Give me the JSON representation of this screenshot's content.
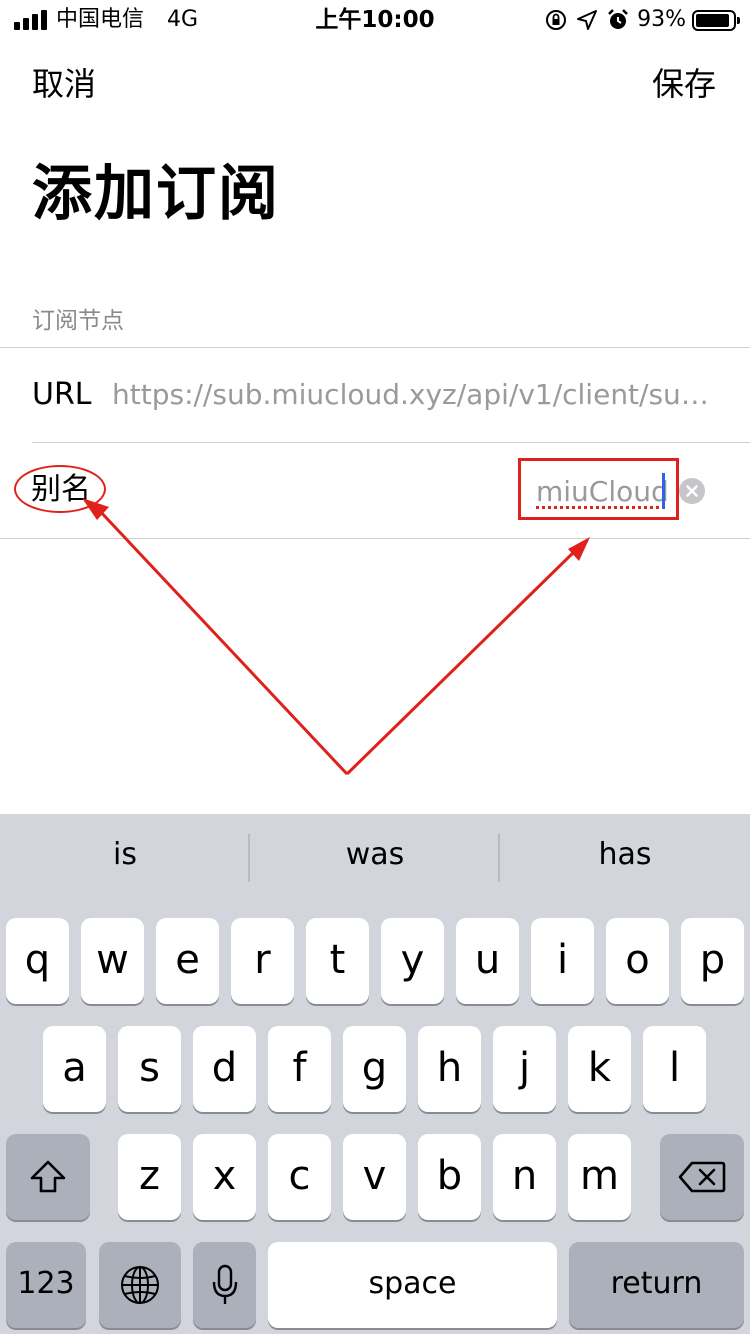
{
  "status_bar": {
    "carrier": "中国电信",
    "network": "4G",
    "time": "上午10:00",
    "battery_percent": "93%",
    "battery_level": 0.93,
    "icons": [
      "signal-icon",
      "orientation-lock-icon",
      "location-icon",
      "alarm-icon",
      "battery-icon"
    ]
  },
  "nav": {
    "cancel_label": "取消",
    "save_label": "保存"
  },
  "page_title": "添加订阅",
  "section_header": "订阅节点",
  "form": {
    "url_label": "URL",
    "url_value": "https://sub.miucloud.xyz/api/v1/client/subs...",
    "alias_label": "别名",
    "alias_value": "miuCloud"
  },
  "annotation_color": "#e0211b",
  "keyboard": {
    "suggestions": [
      "is",
      "was",
      "has"
    ],
    "row1": [
      "q",
      "w",
      "e",
      "r",
      "t",
      "y",
      "u",
      "i",
      "o",
      "p"
    ],
    "row2": [
      "a",
      "s",
      "d",
      "f",
      "g",
      "h",
      "j",
      "k",
      "l"
    ],
    "row3": [
      "z",
      "x",
      "c",
      "v",
      "b",
      "n",
      "m"
    ],
    "numbers_label": "123",
    "space_label": "space",
    "return_label": "return"
  }
}
